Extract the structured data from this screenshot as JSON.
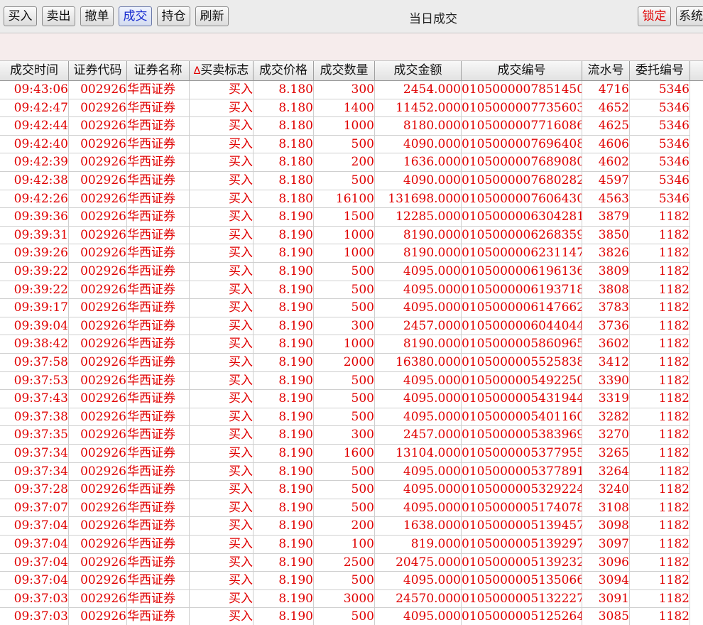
{
  "toolbar": {
    "buttons": [
      "买入",
      "卖出",
      "撤单",
      "成交",
      "持仓",
      "刷新"
    ],
    "active": "成交",
    "title": "当日成交",
    "lock_label": "锁定",
    "system_label": "系统"
  },
  "table": {
    "columns": [
      "成交时间",
      "证券代码",
      "证券名称",
      "买卖标志",
      "成交价格",
      "成交数量",
      "成交金额",
      "成交编号",
      "流水号",
      "委托编号"
    ],
    "sort_indicator": "Δ",
    "rows": [
      [
        "09:43:06",
        "002926",
        "华西证券",
        "买入",
        "8.180",
        "300",
        "2454.000",
        "0105000007851450",
        "4716",
        "5346"
      ],
      [
        "09:42:47",
        "002926",
        "华西证券",
        "买入",
        "8.180",
        "1400",
        "11452.000",
        "0105000007735603",
        "4652",
        "5346"
      ],
      [
        "09:42:44",
        "002926",
        "华西证券",
        "买入",
        "8.180",
        "1000",
        "8180.000",
        "0105000007716086",
        "4625",
        "5346"
      ],
      [
        "09:42:40",
        "002926",
        "华西证券",
        "买入",
        "8.180",
        "500",
        "4090.000",
        "0105000007696408",
        "4606",
        "5346"
      ],
      [
        "09:42:39",
        "002926",
        "华西证券",
        "买入",
        "8.180",
        "200",
        "1636.000",
        "0105000007689080",
        "4602",
        "5346"
      ],
      [
        "09:42:38",
        "002926",
        "华西证券",
        "买入",
        "8.180",
        "500",
        "4090.000",
        "0105000007680282",
        "4597",
        "5346"
      ],
      [
        "09:42:26",
        "002926",
        "华西证券",
        "买入",
        "8.180",
        "16100",
        "131698.000",
        "0105000007606430",
        "4563",
        "5346"
      ],
      [
        "09:39:36",
        "002926",
        "华西证券",
        "买入",
        "8.190",
        "1500",
        "12285.000",
        "0105000006304281",
        "3879",
        "1182"
      ],
      [
        "09:39:31",
        "002926",
        "华西证券",
        "买入",
        "8.190",
        "1000",
        "8190.000",
        "0105000006268359",
        "3850",
        "1182"
      ],
      [
        "09:39:26",
        "002926",
        "华西证券",
        "买入",
        "8.190",
        "1000",
        "8190.000",
        "0105000006231147",
        "3826",
        "1182"
      ],
      [
        "09:39:22",
        "002926",
        "华西证券",
        "买入",
        "8.190",
        "500",
        "4095.000",
        "0105000006196136",
        "3809",
        "1182"
      ],
      [
        "09:39:22",
        "002926",
        "华西证券",
        "买入",
        "8.190",
        "500",
        "4095.000",
        "0105000006193718",
        "3808",
        "1182"
      ],
      [
        "09:39:17",
        "002926",
        "华西证券",
        "买入",
        "8.190",
        "500",
        "4095.000",
        "0105000006147662",
        "3783",
        "1182"
      ],
      [
        "09:39:04",
        "002926",
        "华西证券",
        "买入",
        "8.190",
        "300",
        "2457.000",
        "0105000006044044",
        "3736",
        "1182"
      ],
      [
        "09:38:42",
        "002926",
        "华西证券",
        "买入",
        "8.190",
        "1000",
        "8190.000",
        "0105000005860965",
        "3602",
        "1182"
      ],
      [
        "09:37:58",
        "002926",
        "华西证券",
        "买入",
        "8.190",
        "2000",
        "16380.000",
        "0105000005525838",
        "3412",
        "1182"
      ],
      [
        "09:37:53",
        "002926",
        "华西证券",
        "买入",
        "8.190",
        "500",
        "4095.000",
        "0105000005492250",
        "3390",
        "1182"
      ],
      [
        "09:37:43",
        "002926",
        "华西证券",
        "买入",
        "8.190",
        "500",
        "4095.000",
        "0105000005431944",
        "3319",
        "1182"
      ],
      [
        "09:37:38",
        "002926",
        "华西证券",
        "买入",
        "8.190",
        "500",
        "4095.000",
        "0105000005401160",
        "3282",
        "1182"
      ],
      [
        "09:37:35",
        "002926",
        "华西证券",
        "买入",
        "8.190",
        "300",
        "2457.000",
        "0105000005383969",
        "3270",
        "1182"
      ],
      [
        "09:37:34",
        "002926",
        "华西证券",
        "买入",
        "8.190",
        "1600",
        "13104.000",
        "0105000005377955",
        "3265",
        "1182"
      ],
      [
        "09:37:34",
        "002926",
        "华西证券",
        "买入",
        "8.190",
        "500",
        "4095.000",
        "0105000005377891",
        "3264",
        "1182"
      ],
      [
        "09:37:28",
        "002926",
        "华西证券",
        "买入",
        "8.190",
        "500",
        "4095.000",
        "0105000005329224",
        "3240",
        "1182"
      ],
      [
        "09:37:07",
        "002926",
        "华西证券",
        "买入",
        "8.190",
        "500",
        "4095.000",
        "0105000005174078",
        "3108",
        "1182"
      ],
      [
        "09:37:04",
        "002926",
        "华西证券",
        "买入",
        "8.190",
        "200",
        "1638.000",
        "0105000005139457",
        "3098",
        "1182"
      ],
      [
        "09:37:04",
        "002926",
        "华西证券",
        "买入",
        "8.190",
        "100",
        "819.000",
        "0105000005139297",
        "3097",
        "1182"
      ],
      [
        "09:37:04",
        "002926",
        "华西证券",
        "买入",
        "8.190",
        "2500",
        "20475.000",
        "0105000005139232",
        "3096",
        "1182"
      ],
      [
        "09:37:04",
        "002926",
        "华西证券",
        "买入",
        "8.190",
        "500",
        "4095.000",
        "0105000005135066",
        "3094",
        "1182"
      ],
      [
        "09:37:03",
        "002926",
        "华西证券",
        "买入",
        "8.190",
        "3000",
        "24570.000",
        "0105000005132227",
        "3091",
        "1182"
      ],
      [
        "09:37:03",
        "002926",
        "华西证券",
        "买入",
        "8.190",
        "500",
        "4095.000",
        "0105000005125264",
        "3085",
        "1182"
      ]
    ]
  },
  "colors": {
    "row_text": "#e00000",
    "active_tab": "#1a2fd0",
    "lock_text": "#e00000"
  }
}
